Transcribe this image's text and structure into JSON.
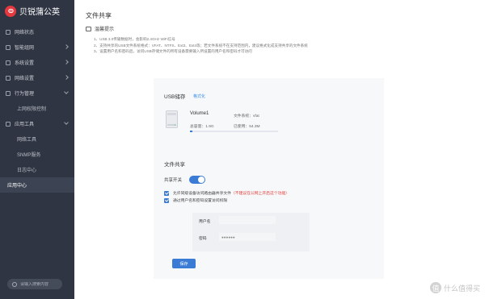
{
  "brand": {
    "name": "贝锐蒲公英"
  },
  "sidebar": {
    "items": [
      {
        "label": "网络状态",
        "type": "item"
      },
      {
        "label": "智能组网",
        "type": "item",
        "chevron": true
      },
      {
        "label": "系统设置",
        "type": "item",
        "chevron": true
      },
      {
        "label": "网络设置",
        "type": "item",
        "chevron": true
      },
      {
        "label": "行为管理",
        "type": "item",
        "chevron": true,
        "open": true
      },
      {
        "label": "上网权限控制",
        "type": "sub"
      },
      {
        "label": "应用工具",
        "type": "item",
        "chevron": true,
        "open": true
      },
      {
        "label": "网络工具",
        "type": "sub"
      },
      {
        "label": "SNMP服务",
        "type": "sub"
      },
      {
        "label": "日志中心",
        "type": "sub"
      },
      {
        "label": "应用中心",
        "type": "item",
        "active": true
      }
    ],
    "search_placeholder": "请输入搜索内容"
  },
  "page": {
    "title": "文件共享",
    "tip_title": "温馨提示",
    "tips": [
      "1、USB 3.0传输数据时，会影响2.4GHz WiFi信号",
      "2、支持共享的USB文件系统格式：VFAT、NTFS、Ext3、Ext4等；若文件系统不在支持范围内，建议格式化成支持共享的文件系统",
      "3、设置用户名和密码后，访问USB存储文件的所有设备需要输入所设置的用户名和密码才可访问"
    ]
  },
  "usb": {
    "section_title": "USB储存",
    "format_label": "格式化",
    "volume_name": "Volume1",
    "fs_label": "文件系统：vfat",
    "total_label": "总容量：1.9G",
    "used_label": "已使用：54.3M",
    "used_fraction": 0.028
  },
  "share": {
    "section_title": "文件共享",
    "toggle_label": "共享开关",
    "toggle_on": true,
    "checkbox1_text": "允许同级设备访问路由器共享文件",
    "checkbox1_warning": "（不建议在公网上开启这个功能）",
    "checkbox2_text": "通过用户名和密码设置访问权限",
    "username_label": "用户名",
    "username_value": "",
    "password_label": "密码",
    "password_value": "●●●●●●",
    "save_label": "保存"
  },
  "watermark": {
    "text": "什么值得买",
    "mark": "值"
  },
  "colors": {
    "accent": "#3a7bd5",
    "sidebar_bg": "#2f3542",
    "warning": "#e53935",
    "brand_red": "#e6393f"
  }
}
